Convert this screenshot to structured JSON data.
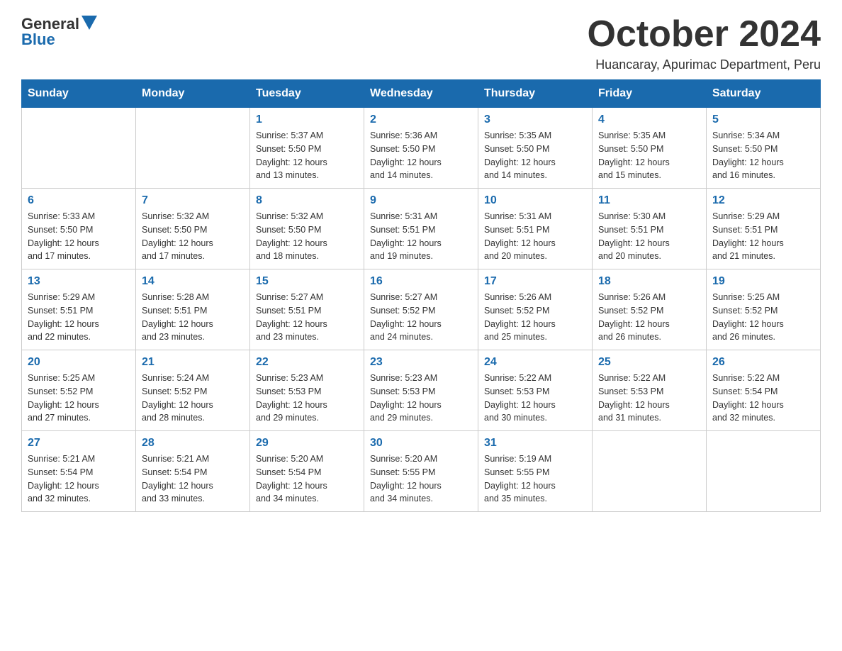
{
  "header": {
    "logo_general": "General",
    "logo_blue": "Blue",
    "month_title": "October 2024",
    "location": "Huancaray, Apurimac Department, Peru"
  },
  "weekdays": [
    "Sunday",
    "Monday",
    "Tuesday",
    "Wednesday",
    "Thursday",
    "Friday",
    "Saturday"
  ],
  "weeks": [
    [
      {
        "day": "",
        "info": ""
      },
      {
        "day": "",
        "info": ""
      },
      {
        "day": "1",
        "info": "Sunrise: 5:37 AM\nSunset: 5:50 PM\nDaylight: 12 hours\nand 13 minutes."
      },
      {
        "day": "2",
        "info": "Sunrise: 5:36 AM\nSunset: 5:50 PM\nDaylight: 12 hours\nand 14 minutes."
      },
      {
        "day": "3",
        "info": "Sunrise: 5:35 AM\nSunset: 5:50 PM\nDaylight: 12 hours\nand 14 minutes."
      },
      {
        "day": "4",
        "info": "Sunrise: 5:35 AM\nSunset: 5:50 PM\nDaylight: 12 hours\nand 15 minutes."
      },
      {
        "day": "5",
        "info": "Sunrise: 5:34 AM\nSunset: 5:50 PM\nDaylight: 12 hours\nand 16 minutes."
      }
    ],
    [
      {
        "day": "6",
        "info": "Sunrise: 5:33 AM\nSunset: 5:50 PM\nDaylight: 12 hours\nand 17 minutes."
      },
      {
        "day": "7",
        "info": "Sunrise: 5:32 AM\nSunset: 5:50 PM\nDaylight: 12 hours\nand 17 minutes."
      },
      {
        "day": "8",
        "info": "Sunrise: 5:32 AM\nSunset: 5:50 PM\nDaylight: 12 hours\nand 18 minutes."
      },
      {
        "day": "9",
        "info": "Sunrise: 5:31 AM\nSunset: 5:51 PM\nDaylight: 12 hours\nand 19 minutes."
      },
      {
        "day": "10",
        "info": "Sunrise: 5:31 AM\nSunset: 5:51 PM\nDaylight: 12 hours\nand 20 minutes."
      },
      {
        "day": "11",
        "info": "Sunrise: 5:30 AM\nSunset: 5:51 PM\nDaylight: 12 hours\nand 20 minutes."
      },
      {
        "day": "12",
        "info": "Sunrise: 5:29 AM\nSunset: 5:51 PM\nDaylight: 12 hours\nand 21 minutes."
      }
    ],
    [
      {
        "day": "13",
        "info": "Sunrise: 5:29 AM\nSunset: 5:51 PM\nDaylight: 12 hours\nand 22 minutes."
      },
      {
        "day": "14",
        "info": "Sunrise: 5:28 AM\nSunset: 5:51 PM\nDaylight: 12 hours\nand 23 minutes."
      },
      {
        "day": "15",
        "info": "Sunrise: 5:27 AM\nSunset: 5:51 PM\nDaylight: 12 hours\nand 23 minutes."
      },
      {
        "day": "16",
        "info": "Sunrise: 5:27 AM\nSunset: 5:52 PM\nDaylight: 12 hours\nand 24 minutes."
      },
      {
        "day": "17",
        "info": "Sunrise: 5:26 AM\nSunset: 5:52 PM\nDaylight: 12 hours\nand 25 minutes."
      },
      {
        "day": "18",
        "info": "Sunrise: 5:26 AM\nSunset: 5:52 PM\nDaylight: 12 hours\nand 26 minutes."
      },
      {
        "day": "19",
        "info": "Sunrise: 5:25 AM\nSunset: 5:52 PM\nDaylight: 12 hours\nand 26 minutes."
      }
    ],
    [
      {
        "day": "20",
        "info": "Sunrise: 5:25 AM\nSunset: 5:52 PM\nDaylight: 12 hours\nand 27 minutes."
      },
      {
        "day": "21",
        "info": "Sunrise: 5:24 AM\nSunset: 5:52 PM\nDaylight: 12 hours\nand 28 minutes."
      },
      {
        "day": "22",
        "info": "Sunrise: 5:23 AM\nSunset: 5:53 PM\nDaylight: 12 hours\nand 29 minutes."
      },
      {
        "day": "23",
        "info": "Sunrise: 5:23 AM\nSunset: 5:53 PM\nDaylight: 12 hours\nand 29 minutes."
      },
      {
        "day": "24",
        "info": "Sunrise: 5:22 AM\nSunset: 5:53 PM\nDaylight: 12 hours\nand 30 minutes."
      },
      {
        "day": "25",
        "info": "Sunrise: 5:22 AM\nSunset: 5:53 PM\nDaylight: 12 hours\nand 31 minutes."
      },
      {
        "day": "26",
        "info": "Sunrise: 5:22 AM\nSunset: 5:54 PM\nDaylight: 12 hours\nand 32 minutes."
      }
    ],
    [
      {
        "day": "27",
        "info": "Sunrise: 5:21 AM\nSunset: 5:54 PM\nDaylight: 12 hours\nand 32 minutes."
      },
      {
        "day": "28",
        "info": "Sunrise: 5:21 AM\nSunset: 5:54 PM\nDaylight: 12 hours\nand 33 minutes."
      },
      {
        "day": "29",
        "info": "Sunrise: 5:20 AM\nSunset: 5:54 PM\nDaylight: 12 hours\nand 34 minutes."
      },
      {
        "day": "30",
        "info": "Sunrise: 5:20 AM\nSunset: 5:55 PM\nDaylight: 12 hours\nand 34 minutes."
      },
      {
        "day": "31",
        "info": "Sunrise: 5:19 AM\nSunset: 5:55 PM\nDaylight: 12 hours\nand 35 minutes."
      },
      {
        "day": "",
        "info": ""
      },
      {
        "day": "",
        "info": ""
      }
    ]
  ]
}
